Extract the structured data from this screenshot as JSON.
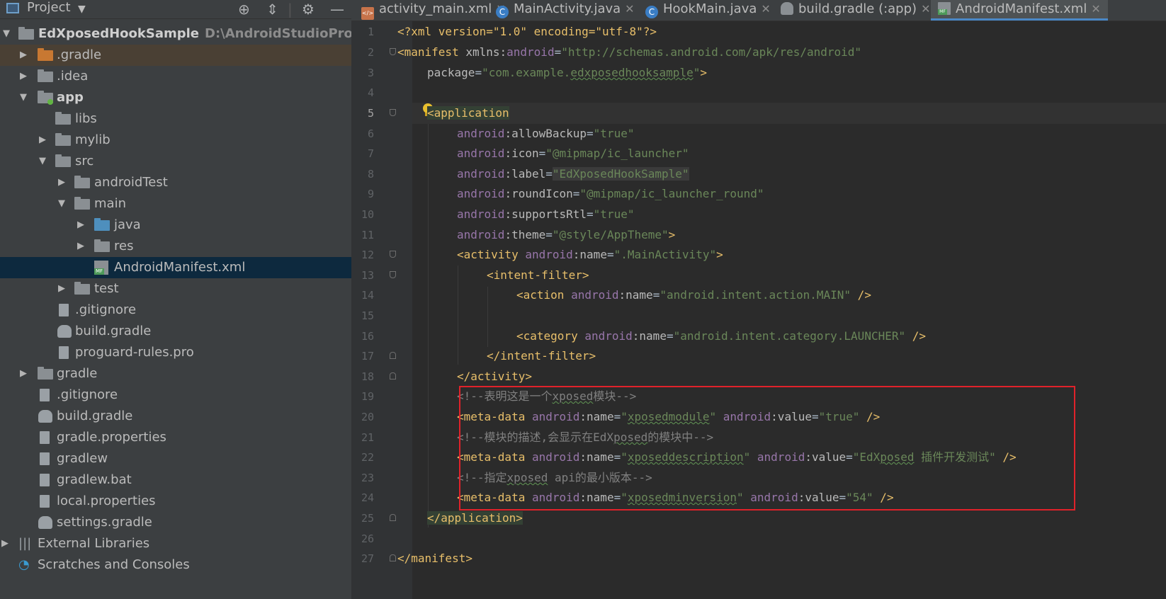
{
  "project_panel": {
    "title": "Project",
    "tree": [
      {
        "label": "EdXposedHookSample",
        "path": "D:\\AndroidStudioProjects\\"
      },
      {
        "label": ".gradle"
      },
      {
        "label": ".idea"
      },
      {
        "label": "app"
      },
      {
        "label": "libs"
      },
      {
        "label": "mylib"
      },
      {
        "label": "src"
      },
      {
        "label": "androidTest"
      },
      {
        "label": "main"
      },
      {
        "label": "java"
      },
      {
        "label": "res"
      },
      {
        "label": "AndroidManifest.xml"
      },
      {
        "label": "test"
      },
      {
        "label": ".gitignore"
      },
      {
        "label": "build.gradle"
      },
      {
        "label": "proguard-rules.pro"
      },
      {
        "label": "gradle"
      },
      {
        "label": ".gitignore"
      },
      {
        "label": "build.gradle"
      },
      {
        "label": "gradle.properties"
      },
      {
        "label": "gradlew"
      },
      {
        "label": "gradlew.bat"
      },
      {
        "label": "local.properties"
      },
      {
        "label": "settings.gradle"
      },
      {
        "label": "External Libraries"
      },
      {
        "label": "Scratches and Consoles"
      }
    ]
  },
  "tabs": [
    {
      "label": "activity_main.xml",
      "icon": "xml-file-icon"
    },
    {
      "label": "MainActivity.java",
      "icon": "java-class-icon"
    },
    {
      "label": "HookMain.java",
      "icon": "java-class-icon"
    },
    {
      "label": "build.gradle (:app)",
      "icon": "gradle-icon"
    },
    {
      "label": "AndroidManifest.xml",
      "icon": "manifest-file-icon",
      "active": true
    }
  ],
  "editor": {
    "current_line": 5,
    "line_numbers": [
      "1",
      "2",
      "3",
      "4",
      "5",
      "6",
      "7",
      "8",
      "9",
      "10",
      "11",
      "12",
      "13",
      "14",
      "15",
      "16",
      "17",
      "18",
      "19",
      "20",
      "21",
      "22",
      "23",
      "24",
      "25",
      "26",
      "27"
    ],
    "code": {
      "l1_decl": "<?xml version=\"1.0\" encoding=\"utf-8\"?>",
      "l2_tag": "<manifest",
      "l2_attr": " xmlns:",
      "l2_ns": "android",
      "l2_eq": "=",
      "l2_val": "\"http://schemas.android.com/apk/res/android\"",
      "l3_attr": "package",
      "l3_eq": "=",
      "l3_val1": "\"com.example.",
      "l3_val2": "edxposedhooksample",
      "l3_val3": "\"",
      "l3_close": ">",
      "l5_tag": "<application",
      "l6_ns": "android",
      "l6_attr": ":allowBackup",
      "l6_val": "\"true\"",
      "l7_ns": "android",
      "l7_attr": ":icon",
      "l7_val": "\"@mipmap/ic_launcher\"",
      "l8_ns": "android",
      "l8_attr": ":label",
      "l8_val": "\"EdXposedHookSample\"",
      "l9_ns": "android",
      "l9_attr": ":roundIcon",
      "l9_val": "\"@mipmap/ic_launcher_round\"",
      "l10_ns": "android",
      "l10_attr": ":supportsRtl",
      "l10_val": "\"true\"",
      "l11_ns": "android",
      "l11_attr": ":theme",
      "l11_val": "\"@style/AppTheme\"",
      "l11_close": ">",
      "l12_tag": "<activity",
      "l12_ns": "android",
      "l12_attr": ":name",
      "l12_val": "\".MainActivity\"",
      "l12_close": ">",
      "l13_tag": "<intent-filter>",
      "l14_tag": "<action",
      "l14_ns": "android",
      "l14_attr": ":name",
      "l14_val": "\"android.intent.action.MAIN\"",
      "l14_close": " />",
      "l16_tag": "<category",
      "l16_ns": "android",
      "l16_attr": ":name",
      "l16_val": "\"android.intent.category.LAUNCHER\"",
      "l16_close": " />",
      "l17_tag": "</intent-filter>",
      "l18_tag": "</activity>",
      "l19_c1": "<!--表明这是一个",
      "l19_c2": "xposed",
      "l19_c3": "模块-->",
      "l20_tag": "<meta-data",
      "l20_ns1": "android",
      "l20_attr1": ":name",
      "l20_v1a": "\"",
      "l20_v1b": "xposedmodule",
      "l20_v1c": "\"",
      "l20_ns2": "android",
      "l20_attr2": ":value",
      "l20_val2": "\"true\"",
      "l20_close": " />",
      "l21_c1": "<!--模块的描述,会显示在EdX",
      "l21_c2": "posed",
      "l21_c3": "的模块中-->",
      "l22_tag": "<meta-data",
      "l22_ns1": "android",
      "l22_attr1": ":name",
      "l22_v1a": "\"",
      "l22_v1b": "xposeddescription",
      "l22_v1c": "\"",
      "l22_ns2": "android",
      "l22_attr2": ":value",
      "l22_v2a": "\"EdX",
      "l22_v2b": "posed",
      "l22_v2c": " 插件开发测试\"",
      "l22_close": " />",
      "l23_c1": "<!--指定",
      "l23_c2": "xposed",
      "l23_c3": " api的最小版本-->",
      "l24_tag": "<meta-data",
      "l24_ns1": "android",
      "l24_attr1": ":name",
      "l24_v1a": "\"",
      "l24_v1b": "xposedminversion",
      "l24_v1c": "\"",
      "l24_ns2": "android",
      "l24_attr2": ":value",
      "l24_val2": "\"54\"",
      "l24_close": " />",
      "l25_tag": "</application>",
      "l27_tag": "</manifest>"
    }
  },
  "colors": {
    "highlight_box": "#e0222a",
    "selection": "#0d293e",
    "active_tab_underline": "#4a88c7"
  }
}
